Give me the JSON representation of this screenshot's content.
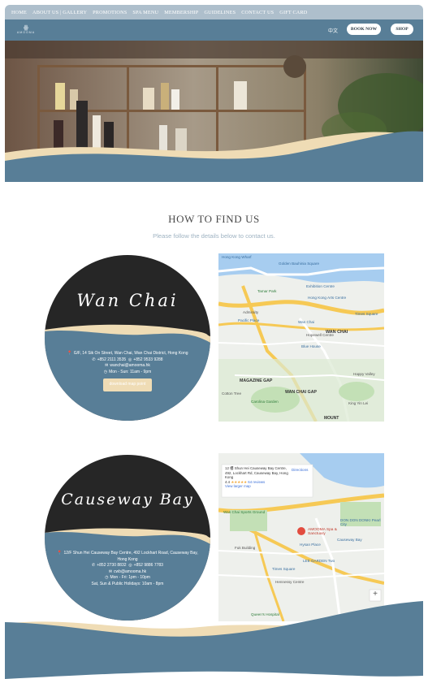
{
  "nav": {
    "items": [
      "HOME",
      "ABOUT US | GALLERY",
      "PROMOTIONS",
      "SPA MENU",
      "MEMBERSHIP",
      "GUIDELINES",
      "CONTACT US",
      "GIFT CARD"
    ]
  },
  "header": {
    "logo_mark": "ꙮ",
    "logo_word": "AMOOMA",
    "lang": "中文",
    "book_label": "BOOK NOW",
    "shop_label": "SHOP"
  },
  "section": {
    "title": "HOW TO FIND US",
    "subtitle": "Please follow the details below to contact us."
  },
  "locations": [
    {
      "name": "Wan Chai",
      "address": "G/F, 14 Sik On Street, Wan Chai, Wan Chai District, Hong Kong",
      "phone": "+852 2111 3535",
      "whatsapp": "+852 9533 9288",
      "email": "wanchai@amooma.hk",
      "hours": [
        "Mon - Sun: 11am - 9pm"
      ],
      "button": "download map point",
      "map_labels": [
        "Hong Kong Wharf",
        "Golden Bauhinia Square",
        "Exhibition Centre",
        "Tamar Park",
        "Hong Kong Arts Centre",
        "Admiralty",
        "Pacific Place",
        "Wan Chai",
        "Hopewell Centre",
        "Blue House",
        "WAN CHAI",
        "Times Square",
        "MAGAZINE GAP",
        "WAN CHAI GAP",
        "Cotton Tree",
        "Carolina Garden",
        "Happy Valley",
        "King Yin Lei",
        "MOUNT"
      ]
    },
    {
      "name": "Causeway Bay",
      "address": "12/F Shun Hei Causeway Bay Centre, 492 Lockhart Road, Causeway Bay, Hong Kong",
      "phone": "+852 2730 8832",
      "whatsapp": "+852 9886 7783",
      "email": "cwb@amooma.hk",
      "hours": [
        "Mon - Fri: 1pm - 10pm",
        "Sat, Sun & Public Holidays: 10am - 8pm"
      ],
      "map_card": {
        "address": "12 樓 Shun Hei Causeway Bay Centre, 492, Lockhart Rd, Causeway Bay, Hong Kong",
        "directions": "Directions",
        "rating": "4.4",
        "stars": "★★★★★",
        "reviews": "64 reviews",
        "larger": "View larger map"
      },
      "map_labels": [
        "Wan Chai Sports Ground",
        "DON DON DONKI Pearl City",
        "AMOOMA Spa & Sanctuary",
        "Causeway Bay",
        "Hysan Place",
        "LEE GARDEN Two",
        "Times Square",
        "Hennessy Centre",
        "Fuk Building",
        "Queen's Hospital"
      ],
      "map_zoom": "+"
    }
  ],
  "colors": {
    "nav_bg": "#aebfcc",
    "header_bg": "#587e97",
    "steel_blue": "#587e97",
    "cream": "#efdcb5",
    "circle_dark": "#262626",
    "map_water": "#a7cdf0",
    "map_road": "#f6c955"
  }
}
